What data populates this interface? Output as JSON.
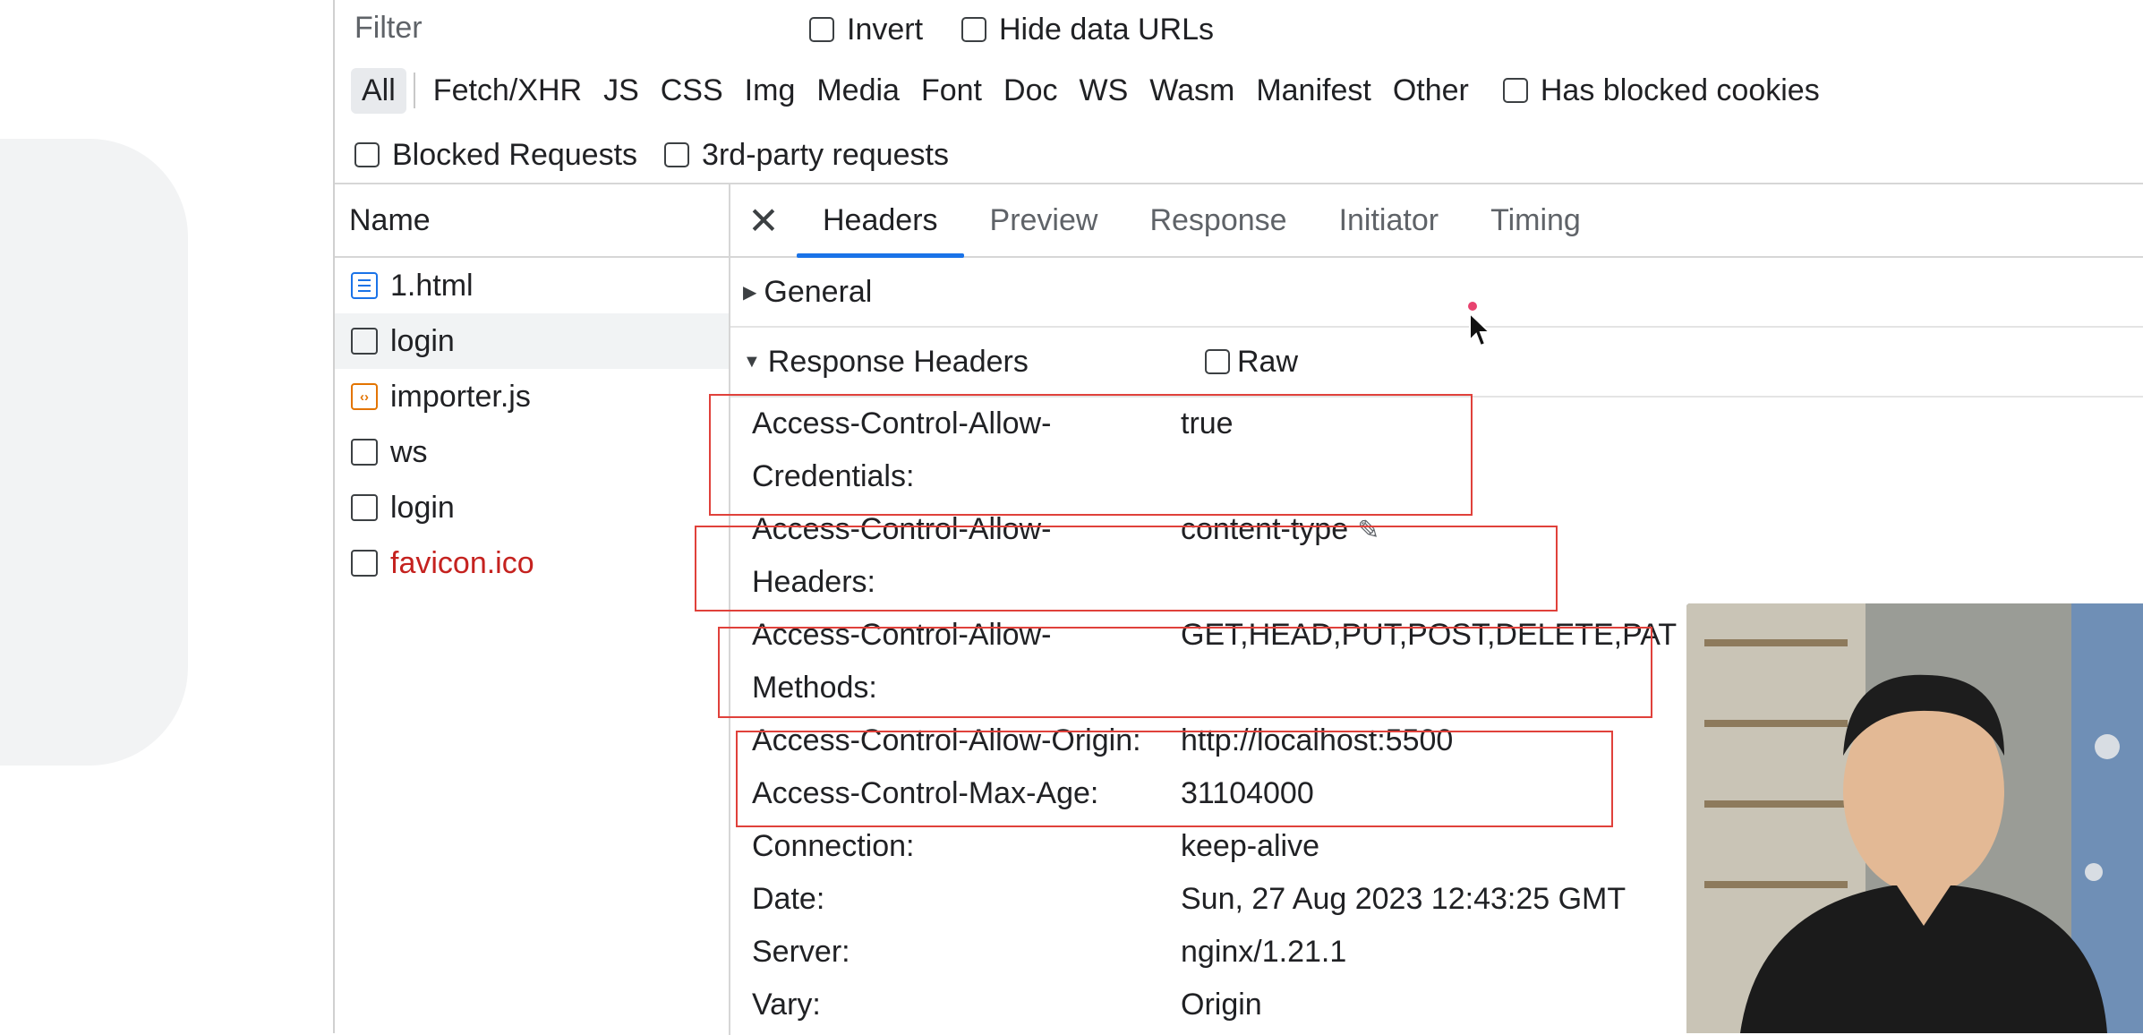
{
  "filter": {
    "label": "Filter",
    "invert": "Invert",
    "hide_data_urls": "Hide data URLs"
  },
  "types": {
    "active": "All",
    "items": [
      "Fetch/XHR",
      "JS",
      "CSS",
      "Img",
      "Media",
      "Font",
      "Doc",
      "WS",
      "Wasm",
      "Manifest",
      "Other"
    ],
    "has_blocked_cookies": "Has blocked cookies"
  },
  "blocked": {
    "blocked_requests": "Blocked Requests",
    "third_party": "3rd-party requests"
  },
  "name_column": {
    "header": "Name",
    "requests": [
      {
        "name": "1.html",
        "icon": "document-icon"
      },
      {
        "name": "login",
        "icon": "blank-file-icon"
      },
      {
        "name": "importer.js",
        "icon": "script-icon"
      },
      {
        "name": "ws",
        "icon": "blank-file-icon"
      },
      {
        "name": "login",
        "icon": "blank-file-icon"
      },
      {
        "name": "favicon.ico",
        "icon": "blank-file-icon",
        "error": true
      }
    ]
  },
  "detail": {
    "close": "✕",
    "tabs": [
      "Headers",
      "Preview",
      "Response",
      "Initiator",
      "Timing"
    ],
    "active_tab": "Headers",
    "general_label": "General",
    "response_headers_label": "Response Headers",
    "raw_label": "Raw",
    "headers": [
      {
        "key": "Access-Control-Allow-",
        "key2": "Credentials:",
        "value": "true"
      },
      {
        "key": "Access-Control-Allow-",
        "key2": "Headers:",
        "value": "content-type"
      },
      {
        "key": "Access-Control-Allow-",
        "key2": "Methods:",
        "value": "GET,HEAD,PUT,POST,DELETE,PAT"
      },
      {
        "key": "Access-Control-Allow-Origin:",
        "value": "http://localhost:5500"
      },
      {
        "key": "Access-Control-Max-Age:",
        "value": "31104000"
      },
      {
        "key": "Connection:",
        "value": "keep-alive"
      },
      {
        "key": "Date:",
        "value": "Sun, 27 Aug 2023 12:43:25 GMT"
      },
      {
        "key": "Server:",
        "value": "nginx/1.21.1"
      },
      {
        "key": "Vary:",
        "value": "Origin"
      }
    ]
  },
  "colors": {
    "accent": "#1a73e8",
    "highlight_box": "#e0413b",
    "error_text": "#c5221f"
  }
}
